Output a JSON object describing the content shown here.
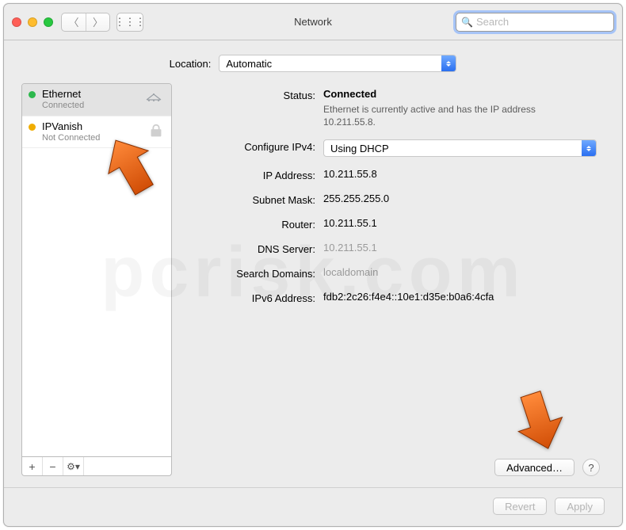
{
  "window": {
    "title": "Network"
  },
  "search": {
    "placeholder": "Search",
    "value": ""
  },
  "location": {
    "label": "Location:",
    "value": "Automatic"
  },
  "sidebar": {
    "items": [
      {
        "name": "Ethernet",
        "status": "Connected",
        "color": "green",
        "icon": "ethernet-icon"
      },
      {
        "name": "IPVanish",
        "status": "Not Connected",
        "color": "yellow",
        "icon": "lock-icon"
      }
    ]
  },
  "status": {
    "label": "Status:",
    "value": "Connected",
    "description": "Ethernet is currently active and has the IP address 10.211.55.8."
  },
  "configure": {
    "label": "Configure IPv4:",
    "value": "Using DHCP"
  },
  "fields": {
    "ip_address": {
      "label": "IP Address:",
      "value": "10.211.55.8"
    },
    "subnet_mask": {
      "label": "Subnet Mask:",
      "value": "255.255.255.0"
    },
    "router": {
      "label": "Router:",
      "value": "10.211.55.1"
    },
    "dns_server": {
      "label": "DNS Server:",
      "value": "10.211.55.1"
    },
    "search_domains": {
      "label": "Search Domains:",
      "value": "localdomain"
    },
    "ipv6_address": {
      "label": "IPv6 Address:",
      "value": "fdb2:2c26:f4e4::10e1:d35e:b0a6:4cfa"
    }
  },
  "buttons": {
    "advanced": "Advanced…",
    "help": "?",
    "revert": "Revert",
    "apply": "Apply",
    "add": "+",
    "remove": "−"
  },
  "colors": {
    "accent": "#2a6ff0",
    "arrow": "#e8661b"
  },
  "watermark": "pcrisk.com"
}
